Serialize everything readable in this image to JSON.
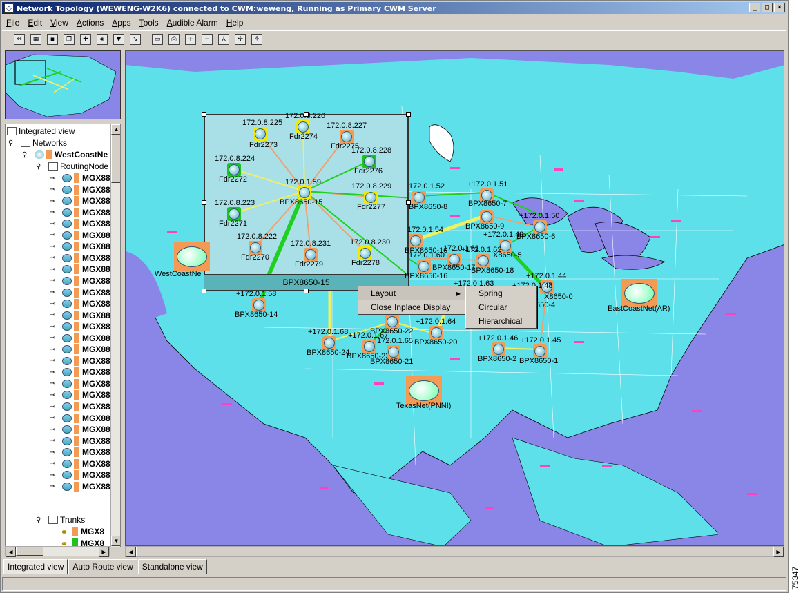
{
  "window": {
    "title": "Network Topology  (WEWENG-W2K6) connected to CWM:weweng, Running as Primary CWM Server",
    "controls": [
      "_",
      "□",
      "×"
    ]
  },
  "menu": [
    "File",
    "Edit",
    "View",
    "Actions",
    "Apps",
    "Tools",
    "Audible Alarm",
    "Help"
  ],
  "toolbar_icons": [
    "link-icon",
    "network-icon",
    "map-icon",
    "copy-icon",
    "new-icon",
    "layer-icon",
    "filter-icon",
    "route-icon",
    "save-icon",
    "print-icon",
    "zoom-in-icon",
    "zoom-out-icon",
    "path-icon",
    "spread-icon",
    "tree-icon"
  ],
  "tree": {
    "root": "Integrated view",
    "networks": "Networks",
    "network": "WestCoastNe",
    "routing": "RoutingNode",
    "node_label": "MGX88",
    "node_count": 28,
    "trunks": "Trunks",
    "trunk_items": [
      "MGX8",
      "MGX8"
    ]
  },
  "inplace": {
    "title": "BPX8650-15",
    "center": {
      "ip": "172.0.1.59",
      "name": "BPX8650-15"
    },
    "nodes": [
      {
        "ip": "172.0.8.225",
        "name": "Fdr2273"
      },
      {
        "ip": "172.0.8.226",
        "name": "Fdr2274"
      },
      {
        "ip": "172.0.8.227",
        "name": "Fdr2275"
      },
      {
        "ip": "172.0.8.228",
        "name": "Fdr2276"
      },
      {
        "ip": "172.0.8.224",
        "name": "Fdr2272"
      },
      {
        "ip": "172.0.8.229",
        "name": "Fdr2277"
      },
      {
        "ip": "172.0.8.223",
        "name": "Fdr2271"
      },
      {
        "ip": "172.0.8.222",
        "name": "Fdr2270"
      },
      {
        "ip": "172.0.8.231",
        "name": "Fdr2279"
      },
      {
        "ip": "172.0.8.230",
        "name": "Fdr2278"
      }
    ]
  },
  "map_nodes": [
    {
      "ip": "+172.0.1.58",
      "name": "BPX8650-14"
    },
    {
      "ip": "172.0.1.52",
      "name": "BPX8650-8"
    },
    {
      "ip": "+172.0.1.51",
      "name": "BPX8650-7"
    },
    {
      "ip": "BPX8650-9",
      "name": ""
    },
    {
      "ip": "+172.0.1.50",
      "name": "BPX8650-6"
    },
    {
      "ip": "+172.0.1.49",
      "name": "X8650-5"
    },
    {
      "ip": "172.0.1.54",
      "name": "BPX8650-10"
    },
    {
      "ip": "172.0.1.60",
      "name": "BPX8650-16"
    },
    {
      "ip": "172.0.1.61",
      "name": "BPX8650-17"
    },
    {
      "ip": "+172.0.1.62",
      "name": "BPX8650-18"
    },
    {
      "ip": "+172.0.1.63",
      "name": ""
    },
    {
      "ip": "+172.0.1.44",
      "name": "X8650-0"
    },
    {
      "ip": "+172.0.1.48",
      "name": "650-4"
    },
    {
      "ip": "BPX8650-22",
      "name": ""
    },
    {
      "ip": "+172.0.1.64",
      "name": "BPX8650-20"
    },
    {
      "ip": "+172.0.1.68",
      "name": "BPX8650-24"
    },
    {
      "ip": "+172.0.1.67",
      "name": "BPX8650-23"
    },
    {
      "ip": "172.0.1.65",
      "name": "BPX8650-21"
    },
    {
      "ip": "+172.0.1.46",
      "name": "BPX8650-2"
    },
    {
      "ip": "+172.0.1.45",
      "name": "BPX8650-1"
    }
  ],
  "clouds": [
    {
      "name": "WestCoastNe"
    },
    {
      "name": "EastCoastNet(AR)"
    },
    {
      "name": "TexasNet(PNNI)"
    }
  ],
  "context_menu": {
    "items": [
      "Layout",
      "Close Inplace Display"
    ],
    "submenu": [
      "Spring",
      "Circular",
      "Hierarchical"
    ]
  },
  "tabs": [
    "Integrated view",
    "Auto Route view",
    "Standalone view"
  ],
  "figure_number": "75347",
  "colors": {
    "map_land": "#5de0ea",
    "map_water": "#8a86e8",
    "inplace_bg": "#a9e0e8",
    "link_green": "#20d020",
    "link_yellow": "#f0f060",
    "link_orange": "#f0a070",
    "node_orange": "#f39a55"
  }
}
